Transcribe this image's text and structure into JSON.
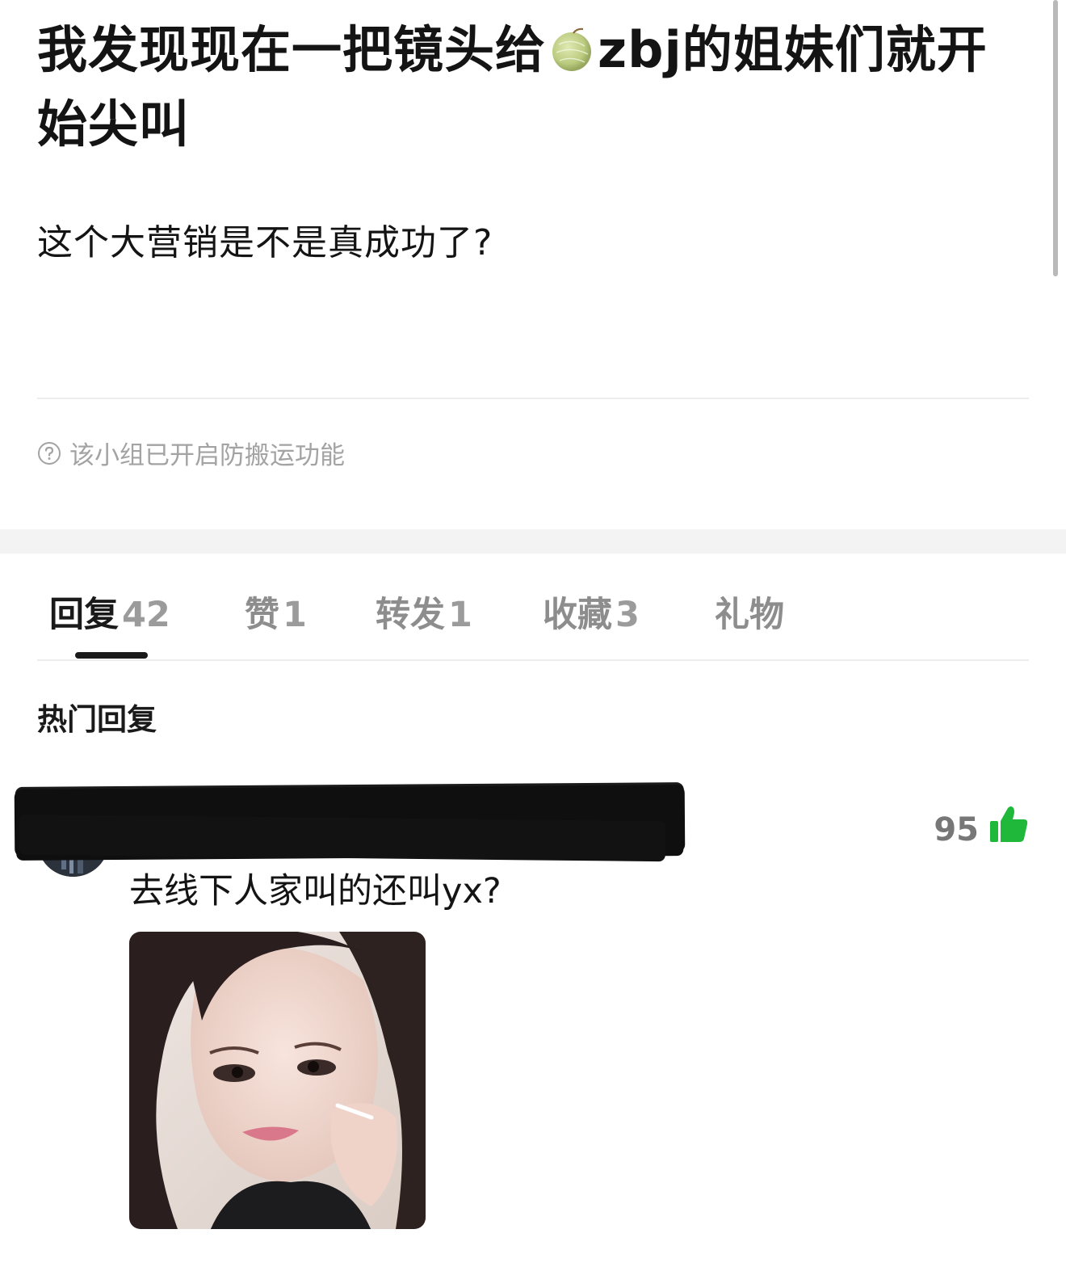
{
  "post": {
    "title_before": "我发现现在一把镜头给",
    "title_emoji": "melon-emoji",
    "title_after": "zbj的姐妹们就开始尖叫",
    "body": "这个大营销是不是真成功了?"
  },
  "notice": {
    "icon": "help-circle-icon",
    "text": "该小组已开启防搬运功能"
  },
  "tabs": [
    {
      "label": "回复",
      "count": "42",
      "active": true
    },
    {
      "label": "赞",
      "count": "1"
    },
    {
      "label": "转发",
      "count": "1"
    },
    {
      "label": "收藏",
      "count": "3"
    },
    {
      "label": "礼物",
      "count": ""
    }
  ],
  "section": {
    "heading": "热门回复"
  },
  "comments": [
    {
      "author_redacted": true,
      "text": "去线下人家叫的还叫yx?",
      "likes": "95",
      "like_icon": "thumbs-up-icon",
      "has_image": true
    }
  ],
  "colors": {
    "accent_green": "#1fb83a",
    "muted_text": "#a3a3a3",
    "tab_inactive": "#8d8d8d",
    "section_band": "#f3f3f3"
  }
}
